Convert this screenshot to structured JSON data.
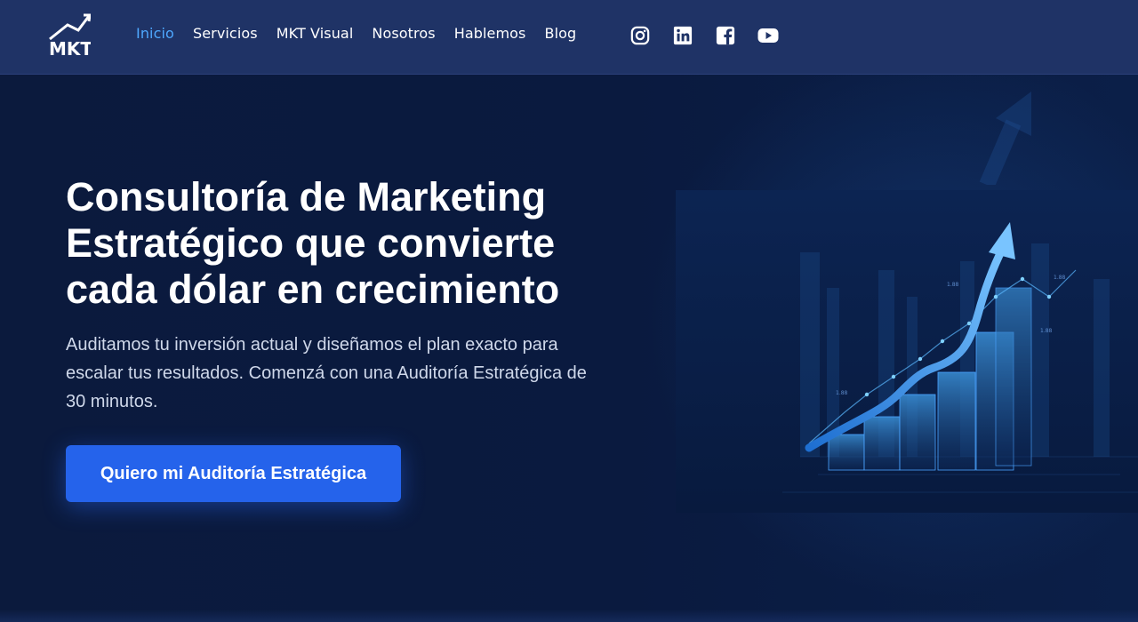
{
  "brand": {
    "logo_text": "MKT",
    "logo_icon": "mkt-logo-icon"
  },
  "nav": {
    "items": [
      {
        "label": "Inicio",
        "active": true
      },
      {
        "label": "Servicios",
        "active": false
      },
      {
        "label": "MKT Visual",
        "active": false
      },
      {
        "label": "Nosotros",
        "active": false
      },
      {
        "label": "Hablemos",
        "active": false
      },
      {
        "label": "Blog",
        "active": false
      }
    ]
  },
  "socials": [
    {
      "icon": "instagram-icon"
    },
    {
      "icon": "linkedin-icon"
    },
    {
      "icon": "facebook-icon"
    },
    {
      "icon": "youtube-icon"
    }
  ],
  "hero": {
    "title": "Consultoría de Marketing Estratégico que convierte cada dólar en crecimiento",
    "subtitle": "Auditamos tu inversión actual y diseñamos el plan exacto para escalar tus resultados. Comenzá con una Auditoría Estratégica de 30 minutos.",
    "cta_label": "Quiero mi Auditoría Estratégica",
    "image": "growth-chart-illustration"
  },
  "colors": {
    "nav_bg": "#1f3366",
    "hero_bg": "#0b1a3d",
    "accent": "#2563eb",
    "active_link": "#4ea8ff"
  }
}
